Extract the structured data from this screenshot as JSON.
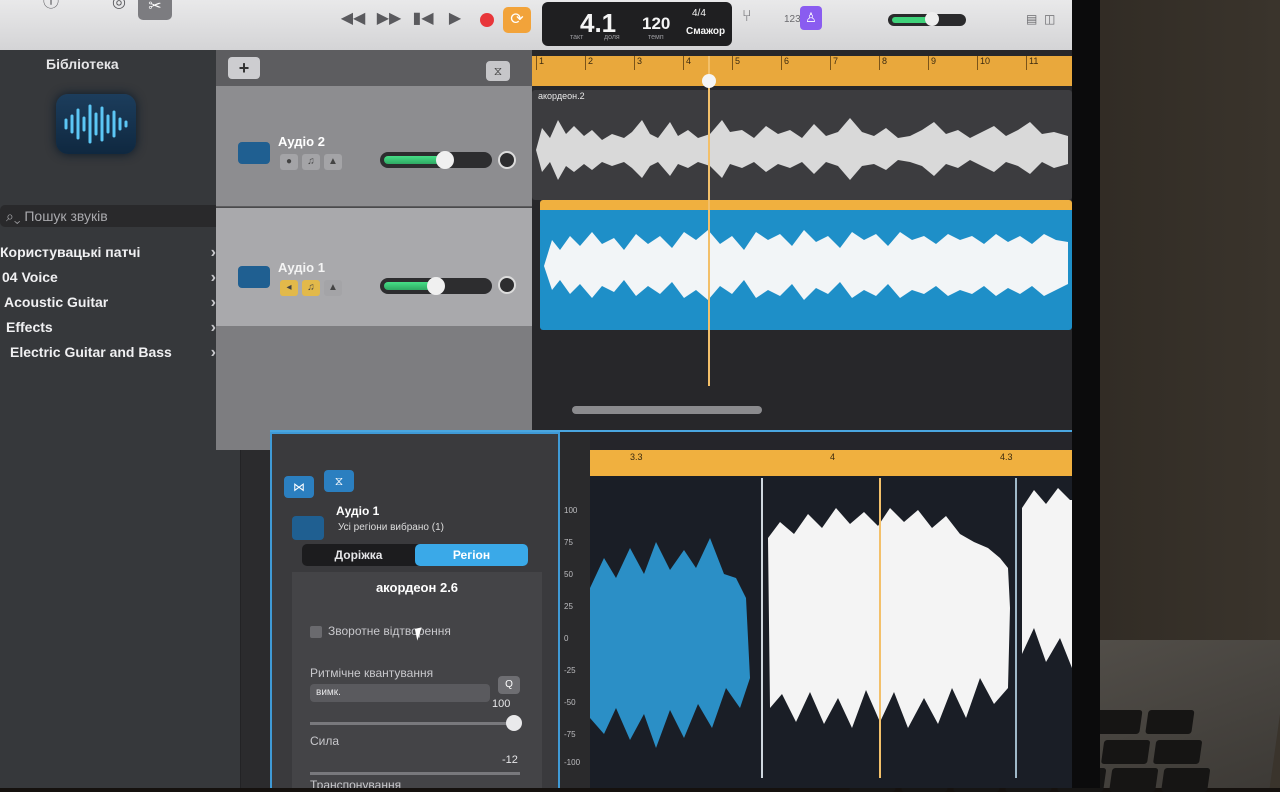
{
  "toolbar": {
    "buttons": [
      "rewind-icon",
      "fast-forward-icon",
      "go-to-start-icon",
      "play-icon",
      "record-icon",
      "cycle-icon"
    ],
    "lcd": {
      "position": "4.1",
      "position_label": "такт",
      "beat_label": "доля",
      "tempo": "120",
      "tempo_label": "темп",
      "signature": "4/4",
      "key": "Cмажор"
    },
    "count_in": "1234",
    "master_volume": 0.7
  },
  "library": {
    "title": "Бібліотека",
    "search_placeholder": "Пошук звуків",
    "items": [
      {
        "label": "Користувацькі патчі"
      },
      {
        "label": "04 Voice"
      },
      {
        "label": "Acoustic Guitar"
      },
      {
        "label": "Effects"
      },
      {
        "label": "Electric Guitar and Bass"
      }
    ]
  },
  "tracks": [
    {
      "name": "Аудіо 2",
      "volume": 0.65,
      "selected": false
    },
    {
      "name": "Аудіо 1",
      "volume": 0.55,
      "selected": true
    }
  ],
  "timeline": {
    "bars": [
      "1",
      "2",
      "3",
      "4",
      "5",
      "6",
      "7",
      "8",
      "9",
      "10",
      "11"
    ],
    "regions": [
      {
        "label": "акордеон.2"
      },
      {
        "label": "акордеон 2.6"
      }
    ]
  },
  "editor": {
    "track_name": "Аудіо 1",
    "subtitle": "Усі регіони вибрано (1)",
    "tabs": [
      "Доріжка",
      "Регіон"
    ],
    "active_tab": 1,
    "region_name": "акордеон 2.6",
    "reverse_label": "Зворотне відтворення",
    "quantize_label": "Ритмічне квантування",
    "quantize_value": "вимк.",
    "strength_label": "Сила",
    "strength_value": "100",
    "transpose_label": "Транспонування",
    "transpose_value": "-12",
    "scale": [
      "100",
      "75",
      "50",
      "25",
      "0",
      "-25",
      "-50",
      "-75",
      "-100"
    ],
    "ruler": [
      "3.3",
      "4",
      "4.3"
    ],
    "region_label": "акордеон 2.6"
  },
  "colors": {
    "accent": "#3aa9e8",
    "region_blue": "#1e8fc8",
    "ruler": "#e9a83c",
    "record": "#e8363a",
    "cycle": "#f2a33a"
  }
}
